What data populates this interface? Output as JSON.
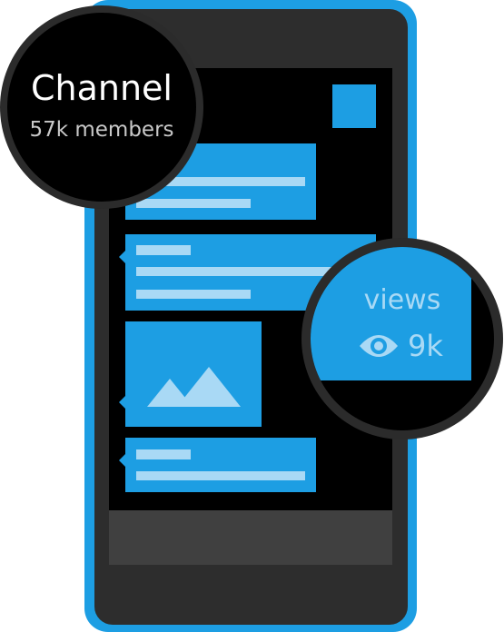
{
  "colors": {
    "accent": "#1d9ee3",
    "accent_light": "#a9d9f5",
    "phone_body": "#2d2d2d",
    "screen": "#000000",
    "nav_bar": "#404040",
    "badge_border": "#2b2b2b"
  },
  "channel_badge": {
    "title": "Channel",
    "subtitle": "57k members"
  },
  "views_badge": {
    "label": "views",
    "count": "9k",
    "icon": "eye-icon"
  },
  "screen": {
    "corner_icon": "square-tile",
    "image_icon": "mountain-image-icon"
  }
}
